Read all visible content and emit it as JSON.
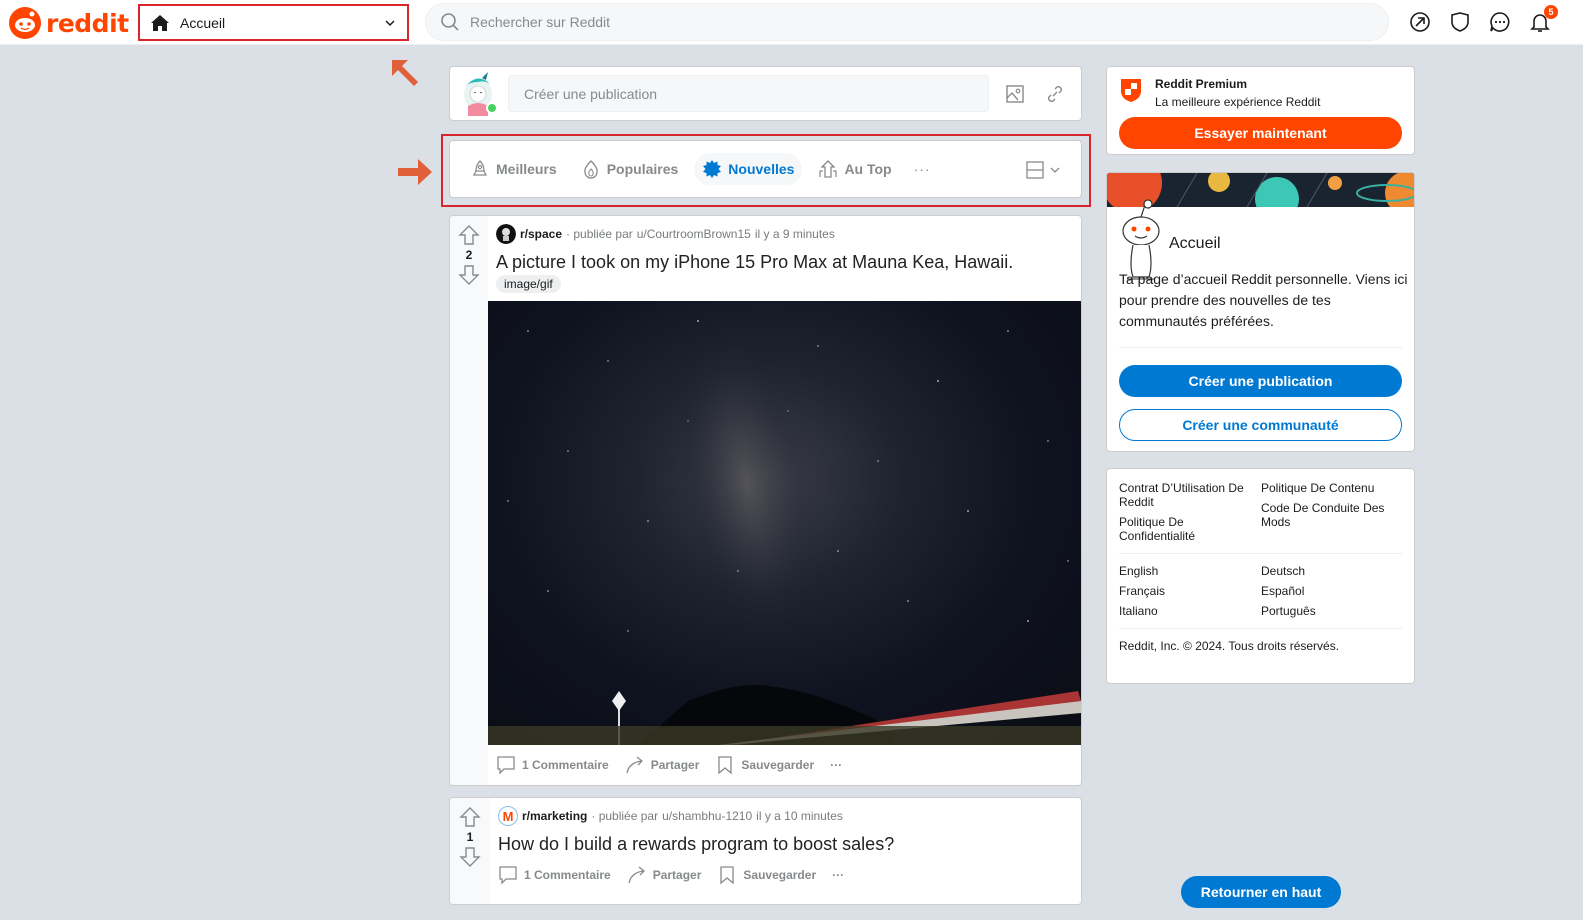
{
  "header": {
    "logo_text": "reddit",
    "home_dropdown_label": "Accueil",
    "search_placeholder": "Rechercher sur Reddit",
    "icons": [
      "popular-icon",
      "shield-icon",
      "chat-icon",
      "bell-icon"
    ],
    "notification_count": "5"
  },
  "create_post": {
    "placeholder": "Créer une publication"
  },
  "sort_bar": {
    "items": [
      {
        "label": "Meilleurs",
        "icon": "rocket-icon",
        "active": false
      },
      {
        "label": "Populaires",
        "icon": "flame-icon",
        "active": false
      },
      {
        "label": "Nouvelles",
        "icon": "burst-icon",
        "active": true
      },
      {
        "label": "Au Top",
        "icon": "top-icon",
        "active": false
      }
    ],
    "more": "···"
  },
  "posts": [
    {
      "votes": "2",
      "subreddit": "r/space",
      "posted_by_prefix": "· publiée par",
      "author": "u/CourtroomBrown15",
      "time": "il y a 9 minutes",
      "title": "A picture I took on my iPhone 15 Pro Max at Mauna Kea, Hawaii.",
      "flair": "image/gif",
      "comments": "1 Commentaire",
      "share": "Partager",
      "save": "Sauvegarder",
      "more": "···"
    },
    {
      "votes": "1",
      "subreddit": "r/marketing",
      "posted_by_prefix": "· publiée par",
      "author": "u/shambhu-1210",
      "time": "il y a 10 minutes",
      "title": "How do I build a rewards program to boost sales?",
      "comments": "1 Commentaire",
      "share": "Partager",
      "save": "Sauvegarder",
      "more": "···"
    }
  ],
  "sidebar": {
    "premium": {
      "title": "Reddit Premium",
      "subtitle": "La meilleure expérience Reddit",
      "button": "Essayer maintenant"
    },
    "home": {
      "title": "Accueil",
      "description": "Ta page d’accueil Reddit personnelle. Viens ici pour prendre des nouvelles de tes communautés préférées.",
      "create_post_button": "Créer une publication",
      "create_community_button": "Créer une communauté"
    },
    "footer": {
      "links_left": [
        "Contrat D’Utilisation De Reddit",
        "Politique De Confidentialité"
      ],
      "links_right": [
        "Politique De Contenu",
        "Code De Conduite Des Mods"
      ],
      "languages": [
        "English",
        "Deutsch",
        "Français",
        "Español",
        "Italiano",
        "Português"
      ],
      "copyright": "Reddit, Inc. © 2024. Tous droits réservés."
    },
    "back_to_top": "Retourner en haut"
  },
  "colors": {
    "brand": "#ff4500",
    "accent_blue": "#0079d3",
    "annotation_red": "#d9262c",
    "annotation_arrow": "#e0603a"
  }
}
